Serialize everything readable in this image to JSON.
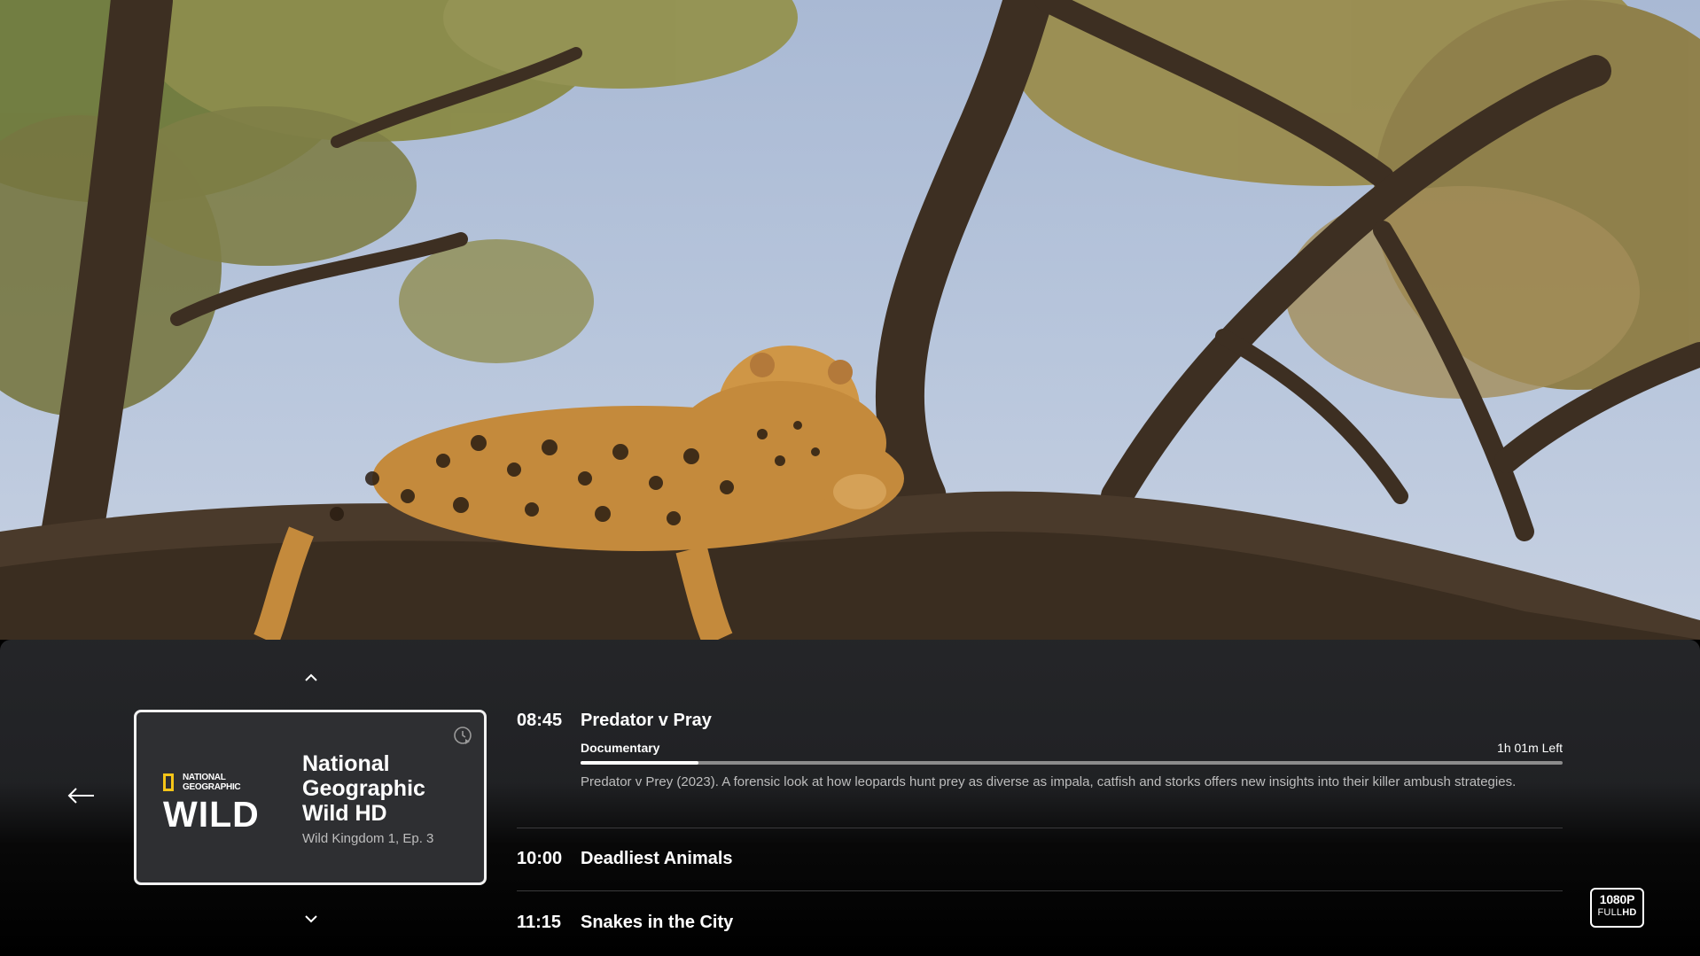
{
  "channel": {
    "logo_small_line1": "NATIONAL",
    "logo_small_line2": "GEOGRAPHIC",
    "logo_main": "WILD",
    "name": "National Geographic Wild HD",
    "episode": "Wild Kingdom 1, Ep. 3"
  },
  "programs": [
    {
      "time": "08:45",
      "title": "Predator v Pray",
      "genre": "Documentary",
      "remaining": "1h 01m Left",
      "progress": 0.12,
      "description": "Predator v Prey (2023). A forensic look at how leopards hunt prey as diverse as impala, catfish and storks offers new insights into their killer ambush strategies."
    },
    {
      "time": "10:00",
      "title": "Deadliest Animals"
    },
    {
      "time": "11:15",
      "title": "Snakes in the City"
    }
  ],
  "quality_badge": {
    "line1": "1080P",
    "line2_a": "FULL",
    "line2_b": "HD"
  },
  "icons": {
    "up": "chevron-up-icon",
    "down": "chevron-down-icon",
    "back": "arrow-left-icon",
    "replay": "replay-clock-icon"
  },
  "colors": {
    "accent_logo": "#f5c518",
    "panel": "#262729",
    "text_secondary": "#bdbdbd"
  }
}
